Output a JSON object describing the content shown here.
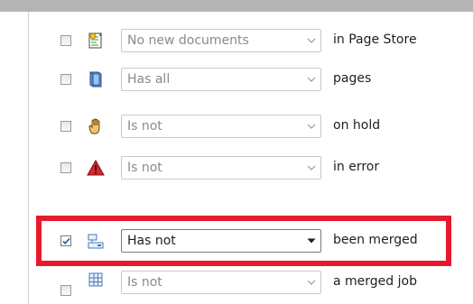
{
  "conditions": [
    {
      "checked": false,
      "icon": "document-star-icon",
      "value": "No new documents",
      "suffix": "in Page Store"
    },
    {
      "checked": false,
      "icon": "pages-book-icon",
      "value": "Has all",
      "suffix": "pages"
    },
    {
      "checked": false,
      "icon": "hand-hold-icon",
      "value": "Is not",
      "suffix": "on hold"
    },
    {
      "checked": false,
      "icon": "error-triangle-icon",
      "value": "Is not",
      "suffix": "in error"
    },
    {
      "checked": true,
      "icon": "merge-icon",
      "value": "Has not",
      "suffix": "been merged"
    },
    {
      "checked": false,
      "icon": "grid-job-icon",
      "value": "Is not",
      "suffix": "a merged job"
    }
  ],
  "colors": {
    "highlight": "#e8192c"
  }
}
